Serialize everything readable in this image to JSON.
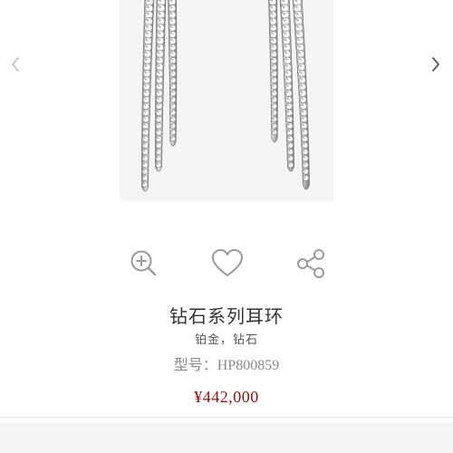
{
  "gallery": {
    "image_alt": "diamond earrings product photo",
    "prev_icon": "chevron-left-icon",
    "next_icon": "chevron-right-icon"
  },
  "actions": [
    {
      "name": "zoom",
      "icon": "zoom-in-icon"
    },
    {
      "name": "wishlist",
      "icon": "heart-icon"
    },
    {
      "name": "share",
      "icon": "share-icon"
    }
  ],
  "product": {
    "title": "钻石系列耳环",
    "material": "铂金，钻石",
    "model_label": "型号：",
    "model_value": "HP800859",
    "price": "¥442,000"
  },
  "colors": {
    "price": "#8b1414",
    "icon": "#9a9a9a",
    "arrow_prev": "#c4c4c4",
    "arrow_next": "#555555",
    "image_bg": "#f5f5f5"
  }
}
